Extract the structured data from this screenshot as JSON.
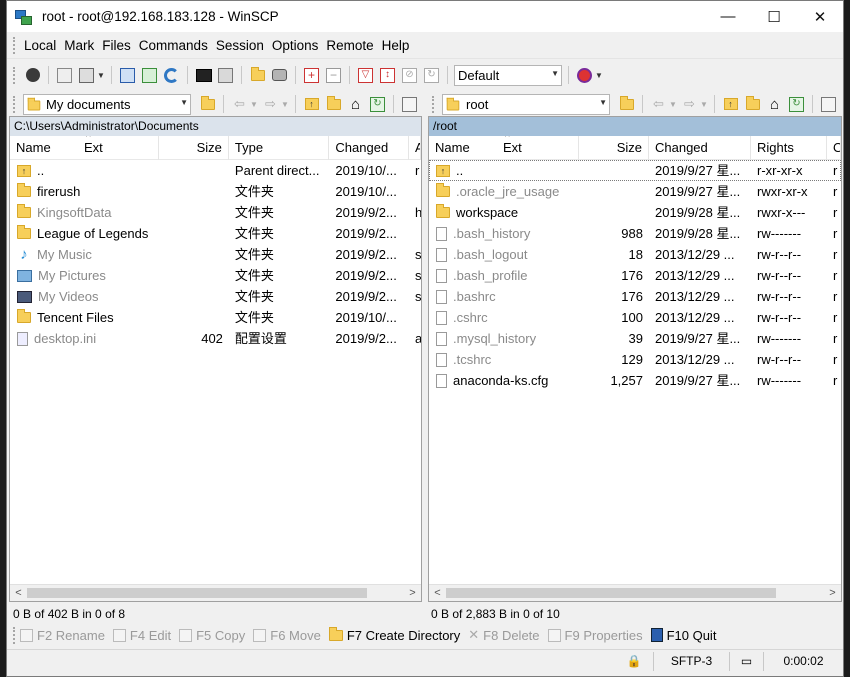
{
  "window": {
    "title": "root - root@192.168.183.128 - WinSCP",
    "minimize": "—",
    "maximize": "☐",
    "close": "✕"
  },
  "menu": [
    "Local",
    "Mark",
    "Files",
    "Commands",
    "Session",
    "Options",
    "Remote",
    "Help"
  ],
  "toolbar": {
    "transfer_settings": "Default"
  },
  "local": {
    "location": "My documents",
    "path": "C:\\Users\\Administrator\\Documents",
    "columns": [
      "Name",
      "Ext",
      "Size",
      "Type",
      "Changed",
      "A"
    ],
    "rows": [
      {
        "name": "..",
        "size": "",
        "type": "Parent direct...",
        "changed": "2019/10/...",
        "attr": "r",
        "icon": "up-icon",
        "dim": false
      },
      {
        "name": "firerush",
        "size": "",
        "type": "文件夹",
        "changed": "2019/10/...",
        "attr": "",
        "icon": "folder-icon",
        "dim": false
      },
      {
        "name": "KingsoftData",
        "size": "",
        "type": "文件夹",
        "changed": "2019/9/2...",
        "attr": "h",
        "icon": "folder-icon",
        "dim": true
      },
      {
        "name": "League of Legends",
        "size": "",
        "type": "文件夹",
        "changed": "2019/9/2...",
        "attr": "",
        "icon": "folder-icon",
        "dim": false
      },
      {
        "name": "My Music",
        "size": "",
        "type": "文件夹",
        "changed": "2019/9/2...",
        "attr": "s",
        "icon": "music-icon",
        "dim": true
      },
      {
        "name": "My Pictures",
        "size": "",
        "type": "文件夹",
        "changed": "2019/9/2...",
        "attr": "s",
        "icon": "pictures-icon",
        "dim": true
      },
      {
        "name": "My Videos",
        "size": "",
        "type": "文件夹",
        "changed": "2019/9/2...",
        "attr": "s",
        "icon": "videos-icon",
        "dim": true
      },
      {
        "name": "Tencent Files",
        "size": "",
        "type": "文件夹",
        "changed": "2019/10/...",
        "attr": "",
        "icon": "folder-icon",
        "dim": false
      },
      {
        "name": "desktop.ini",
        "size": "402",
        "type": "配置设置",
        "changed": "2019/9/2...",
        "attr": "a",
        "icon": "ini-file-icon",
        "dim": true
      }
    ],
    "status": "0 B of 402 B in 0 of 8"
  },
  "remote": {
    "location": "root",
    "path": "/root",
    "columns": [
      "Name",
      "Ext",
      "Size",
      "Changed",
      "Rights",
      "O"
    ],
    "rows": [
      {
        "name": "..",
        "size": "",
        "changed": "2019/9/27 星...",
        "rights": "r-xr-xr-x",
        "owner": "r",
        "icon": "up-icon",
        "dim": false
      },
      {
        "name": ".oracle_jre_usage",
        "size": "",
        "changed": "2019/9/27 星...",
        "rights": "rwxr-xr-x",
        "owner": "r",
        "icon": "folder-icon",
        "dim": true
      },
      {
        "name": "workspace",
        "size": "",
        "changed": "2019/9/28 星...",
        "rights": "rwxr-x---",
        "owner": "r",
        "icon": "folder-icon",
        "dim": false
      },
      {
        "name": ".bash_history",
        "size": "988",
        "changed": "2019/9/28 星...",
        "rights": "rw-------",
        "owner": "r",
        "icon": "file-icon",
        "dim": true
      },
      {
        "name": ".bash_logout",
        "size": "18",
        "changed": "2013/12/29 ...",
        "rights": "rw-r--r--",
        "owner": "r",
        "icon": "file-icon",
        "dim": true
      },
      {
        "name": ".bash_profile",
        "size": "176",
        "changed": "2013/12/29 ...",
        "rights": "rw-r--r--",
        "owner": "r",
        "icon": "file-icon",
        "dim": true
      },
      {
        "name": ".bashrc",
        "size": "176",
        "changed": "2013/12/29 ...",
        "rights": "rw-r--r--",
        "owner": "r",
        "icon": "file-icon",
        "dim": true
      },
      {
        "name": ".cshrc",
        "size": "100",
        "changed": "2013/12/29 ...",
        "rights": "rw-r--r--",
        "owner": "r",
        "icon": "file-icon",
        "dim": true
      },
      {
        "name": ".mysql_history",
        "size": "39",
        "changed": "2019/9/27 星...",
        "rights": "rw-------",
        "owner": "r",
        "icon": "file-icon",
        "dim": true
      },
      {
        "name": ".tcshrc",
        "size": "129",
        "changed": "2013/12/29 ...",
        "rights": "rw-r--r--",
        "owner": "r",
        "icon": "file-icon",
        "dim": true
      },
      {
        "name": "anaconda-ks.cfg",
        "size": "1,257",
        "changed": "2019/9/27 星...",
        "rights": "rw-------",
        "owner": "r",
        "icon": "file-icon",
        "dim": false
      }
    ],
    "status": "0 B of 2,883 B in 0 of 10"
  },
  "commands": [
    {
      "label": "F2 Rename",
      "name": "rename-command",
      "icon": "rename-icon",
      "enabled": false
    },
    {
      "label": "F4 Edit",
      "name": "edit-command",
      "icon": "edit-icon",
      "enabled": false
    },
    {
      "label": "F5 Copy",
      "name": "copy-command",
      "icon": "copy-icon",
      "enabled": false
    },
    {
      "label": "F6 Move",
      "name": "move-command",
      "icon": "move-icon",
      "enabled": false
    },
    {
      "label": "F7 Create Directory",
      "name": "create-directory-command",
      "icon": "new-folder-icon",
      "enabled": true
    },
    {
      "label": "F8 Delete",
      "name": "delete-command",
      "icon": "delete-icon",
      "enabled": false
    },
    {
      "label": "F9 Properties",
      "name": "properties-command",
      "icon": "properties-icon",
      "enabled": false
    },
    {
      "label": "F10 Quit",
      "name": "quit-command",
      "icon": "quit-icon",
      "enabled": true
    }
  ],
  "statusbar": {
    "protocol": "SFTP-3",
    "elapsed": "0:00:02"
  },
  "colors": {
    "remote_path_bg": "#a3bfd9",
    "local_path_bg": "#dbe3ec",
    "dim_text": "#8a8a8a",
    "folder": "#f7cf5a"
  }
}
